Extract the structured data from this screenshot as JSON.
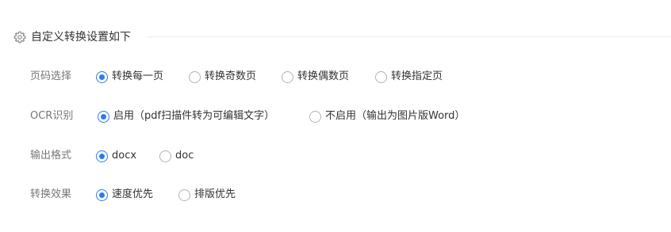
{
  "header": {
    "icon": "gear-icon",
    "title": "自定义转换设置如下"
  },
  "accent_color": "#2b7de9",
  "settings": [
    {
      "label": "页码选择",
      "options": [
        {
          "text": "转换每一页",
          "checked": true
        },
        {
          "text": "转换奇数页",
          "checked": false
        },
        {
          "text": "转换偶数页",
          "checked": false
        },
        {
          "text": "转换指定页",
          "checked": false
        }
      ]
    },
    {
      "label": "OCR识别",
      "options": [
        {
          "text": "启用（pdf扫描件转为可编辑文字）",
          "checked": true
        },
        {
          "text": "不启用（输出为图片版Word）",
          "checked": false
        }
      ]
    },
    {
      "label": "输出格式",
      "options": [
        {
          "text": "docx",
          "checked": true
        },
        {
          "text": "doc",
          "checked": false
        }
      ]
    },
    {
      "label": "转换效果",
      "options": [
        {
          "text": "速度优先",
          "checked": true
        },
        {
          "text": "排版优先",
          "checked": false
        }
      ]
    }
  ]
}
